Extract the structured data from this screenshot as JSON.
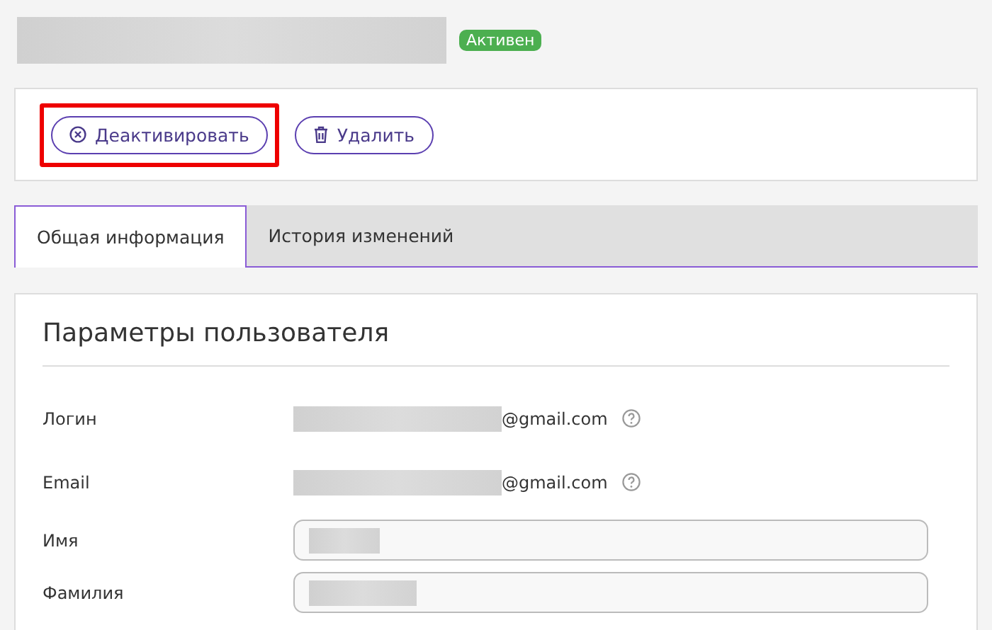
{
  "header": {
    "status_badge": "Активен"
  },
  "actions": [
    {
      "label": "Деактивировать",
      "kind": "deactivate",
      "highlighted": true
    },
    {
      "label": "Удалить",
      "kind": "delete",
      "highlighted": false
    }
  ],
  "tabs": [
    {
      "label": "Общая информация",
      "selected": true
    },
    {
      "label": "История изменений",
      "selected": false
    }
  ],
  "section": {
    "title": "Параметры пользователя",
    "fields": [
      {
        "label": "Логин",
        "kind": "text",
        "value": "@gmail.com"
      },
      {
        "label": "Email",
        "kind": "text",
        "value": "@gmail.com"
      },
      {
        "label": "Имя",
        "kind": "input"
      },
      {
        "label": "Фамилия",
        "kind": "input"
      }
    ]
  }
}
